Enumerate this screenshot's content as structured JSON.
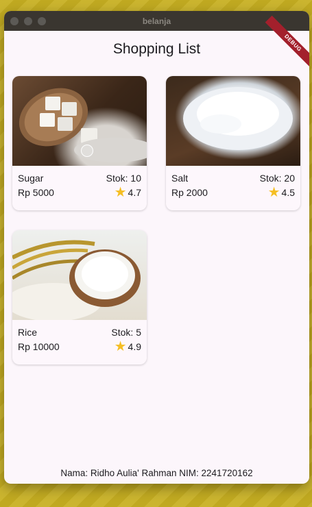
{
  "window": {
    "title": "belanja"
  },
  "debug_banner": "DEBUG",
  "app_bar": {
    "title": "Shopping List"
  },
  "products": [
    {
      "name": "Sugar",
      "price": "Rp 5000",
      "stock": "Stok: 10",
      "rating": "4.7",
      "image": "sugar-image"
    },
    {
      "name": "Salt",
      "price": "Rp 2000",
      "stock": "Stok: 20",
      "rating": "4.5",
      "image": "salt-image"
    },
    {
      "name": "Rice",
      "price": "Rp 10000",
      "stock": "Stok: 5",
      "rating": "4.9",
      "image": "rice-image"
    }
  ],
  "footer": {
    "text": "Nama: Ridho Aulia' Rahman NIM: 2241720162"
  },
  "colors": {
    "star": "#f5be23",
    "background": "#fcf6fb",
    "titlebar": "#3a3630",
    "debug": "#a3202c"
  }
}
